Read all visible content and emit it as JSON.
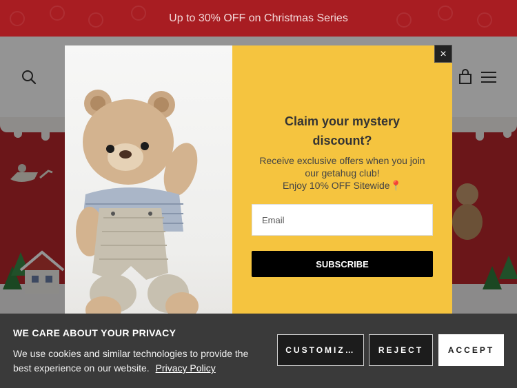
{
  "announcement": {
    "text": "Up to 30% OFF on Christmas Series"
  },
  "header": {
    "icons": [
      "search-icon",
      "cart-icon",
      "menu-icon"
    ]
  },
  "popup": {
    "close_label": "×",
    "headline_line1": "Claim your mystery",
    "headline_line2": "discount?",
    "offer_line1": "Receive exclusive offers when you join",
    "offer_line2": "our getahug club!",
    "offer_line3": "Enjoy 10% OFF Sitewide📍",
    "email_placeholder": "Email",
    "subscribe_label": "SUBSCRIBE",
    "accent_color": "#f5c43f"
  },
  "cookie": {
    "title": "WE CARE ABOUT YOUR PRIVACY",
    "body": "We use cookies and similar technologies to provide the best experience on our website.",
    "policy_link": "Privacy Policy",
    "customize_label": "CUSTOMIZ…",
    "reject_label": "REJECT",
    "accept_label": "ACCEPT"
  },
  "colors": {
    "announcement_bg": "#a81d22",
    "hero_bg": "#b9262b"
  }
}
